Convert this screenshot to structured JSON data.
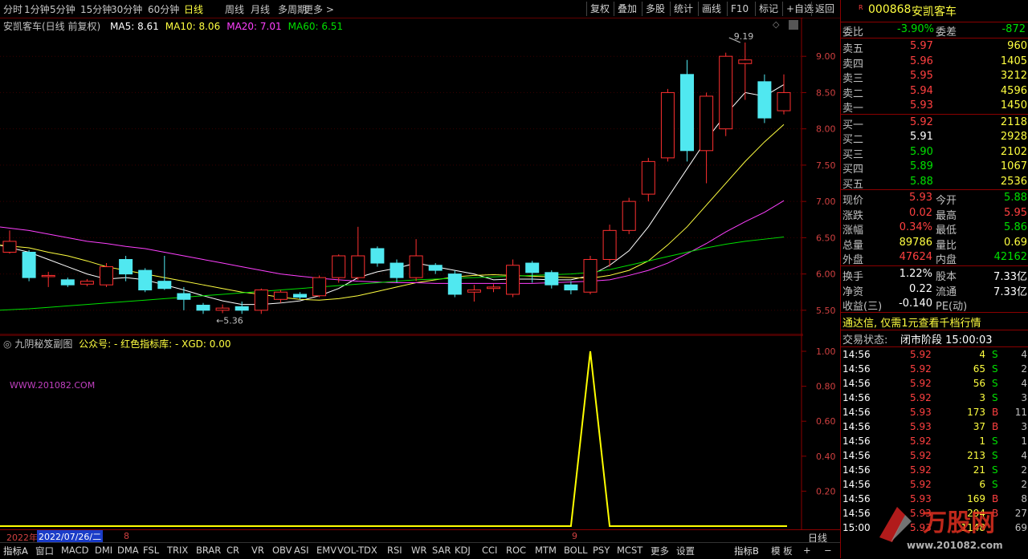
{
  "toolbar": {
    "periods": [
      "分时",
      "1分钟",
      "5分钟",
      "15分钟",
      "30分钟",
      "60分钟",
      "日线",
      "周线",
      "月线",
      "多周期",
      "更多 >"
    ],
    "active_period": "日线",
    "right_buttons": [
      "复权",
      "叠加",
      "多股",
      "统计",
      "画线",
      "F10",
      "标记",
      "+自选",
      "返回"
    ]
  },
  "main_chart": {
    "stock_label": "安凯客车(日线 前复权)",
    "ma_legend": [
      {
        "label": "MA5: 8.61",
        "color": "#ffffff"
      },
      {
        "label": "MA10: 8.06",
        "color": "#ffff40"
      },
      {
        "label": "MA20: 7.01",
        "color": "#ff40ff"
      },
      {
        "label": "MA60: 6.51",
        "color": "#00e000"
      }
    ],
    "high_annotation": "9.19",
    "low_annotation": "5.36",
    "price_ticks": [
      "9.00",
      "8.50",
      "8.00",
      "7.50",
      "7.00",
      "6.50",
      "6.00",
      "5.50"
    ]
  },
  "chart_data": {
    "type": "candlestick",
    "y_range": [
      5.2,
      9.4
    ],
    "candles": [
      {
        "o": 6.3,
        "c": 6.45,
        "h": 6.6,
        "l": 6.28
      },
      {
        "o": 6.3,
        "c": 5.95,
        "h": 6.33,
        "l": 5.9
      },
      {
        "o": 5.98,
        "c": 5.98,
        "h": 6.03,
        "l": 5.82
      },
      {
        "o": 5.92,
        "c": 5.85,
        "h": 5.95,
        "l": 5.82
      },
      {
        "o": 5.86,
        "c": 5.9,
        "h": 5.93,
        "l": 5.83
      },
      {
        "o": 5.85,
        "c": 6.1,
        "h": 6.15,
        "l": 5.82
      },
      {
        "o": 6.2,
        "c": 6.0,
        "h": 6.25,
        "l": 5.9
      },
      {
        "o": 6.05,
        "c": 5.78,
        "h": 6.08,
        "l": 5.75
      },
      {
        "o": 5.9,
        "c": 5.8,
        "h": 6.25,
        "l": 5.78
      },
      {
        "o": 5.73,
        "c": 5.65,
        "h": 5.82,
        "l": 5.5
      },
      {
        "o": 5.57,
        "c": 5.5,
        "h": 5.6,
        "l": 5.45
      },
      {
        "o": 5.5,
        "c": 5.53,
        "h": 5.58,
        "l": 5.46
      },
      {
        "o": 5.55,
        "c": 5.5,
        "h": 5.62,
        "l": 5.45
      },
      {
        "o": 5.5,
        "c": 5.78,
        "h": 5.8,
        "l": 5.45
      },
      {
        "o": 5.65,
        "c": 5.75,
        "h": 5.78,
        "l": 5.6
      },
      {
        "o": 5.72,
        "c": 5.68,
        "h": 5.75,
        "l": 5.65
      },
      {
        "o": 5.7,
        "c": 5.95,
        "h": 5.98,
        "l": 5.68
      },
      {
        "o": 5.95,
        "c": 6.25,
        "h": 6.27,
        "l": 5.88
      },
      {
        "o": 5.95,
        "c": 6.25,
        "h": 6.65,
        "l": 5.92
      },
      {
        "o": 6.35,
        "c": 6.15,
        "h": 6.38,
        "l": 6.1
      },
      {
        "o": 6.15,
        "c": 5.95,
        "h": 6.2,
        "l": 5.88
      },
      {
        "o": 5.95,
        "c": 6.25,
        "h": 6.48,
        "l": 5.9
      },
      {
        "o": 6.12,
        "c": 6.05,
        "h": 6.15,
        "l": 6.0
      },
      {
        "o": 6.0,
        "c": 5.72,
        "h": 6.05,
        "l": 5.68
      },
      {
        "o": 5.75,
        "c": 5.78,
        "h": 5.85,
        "l": 5.62
      },
      {
        "o": 5.8,
        "c": 5.82,
        "h": 5.86,
        "l": 5.75
      },
      {
        "o": 5.72,
        "c": 6.12,
        "h": 6.2,
        "l": 5.68
      },
      {
        "o": 6.15,
        "c": 6.02,
        "h": 6.18,
        "l": 5.88
      },
      {
        "o": 6.02,
        "c": 5.85,
        "h": 6.05,
        "l": 5.8
      },
      {
        "o": 5.85,
        "c": 5.78,
        "h": 5.9,
        "l": 5.72
      },
      {
        "o": 5.75,
        "c": 6.2,
        "h": 6.25,
        "l": 5.72
      },
      {
        "o": 6.2,
        "c": 6.6,
        "h": 6.68,
        "l": 6.1
      },
      {
        "o": 6.6,
        "c": 7.0,
        "h": 7.05,
        "l": 6.55
      },
      {
        "o": 7.1,
        "c": 7.55,
        "h": 7.6,
        "l": 7.0
      },
      {
        "o": 7.6,
        "c": 8.5,
        "h": 8.55,
        "l": 7.55
      },
      {
        "o": 8.75,
        "c": 7.7,
        "h": 8.95,
        "l": 7.55
      },
      {
        "o": 7.7,
        "c": 8.45,
        "h": 8.5,
        "l": 7.25
      },
      {
        "o": 8.0,
        "c": 9.0,
        "h": 9.05,
        "l": 7.9
      },
      {
        "o": 8.9,
        "c": 8.95,
        "h": 9.19,
        "l": 8.4
      },
      {
        "o": 8.65,
        "c": 8.15,
        "h": 8.75,
        "l": 8.08
      },
      {
        "o": 8.25,
        "c": 8.5,
        "h": 8.75,
        "l": 8.2
      }
    ],
    "ma_lines": {
      "MA5": [
        6.4,
        6.3,
        6.2,
        6.1,
        6.0,
        5.93,
        5.95,
        5.92,
        5.85,
        5.78,
        5.7,
        5.63,
        5.58,
        5.58,
        5.6,
        5.63,
        5.7,
        5.8,
        5.95,
        6.03,
        6.08,
        6.15,
        6.1,
        6.05,
        6.0,
        5.92,
        5.93,
        5.93,
        5.92,
        5.92,
        5.98,
        6.12,
        6.32,
        6.65,
        7.05,
        7.45,
        7.85,
        8.2,
        8.5,
        8.45,
        8.61
      ],
      "MA10": [
        6.4,
        6.36,
        6.3,
        6.25,
        6.18,
        6.1,
        6.05,
        6.0,
        5.95,
        5.9,
        5.85,
        5.8,
        5.75,
        5.72,
        5.68,
        5.65,
        5.64,
        5.66,
        5.7,
        5.76,
        5.82,
        5.88,
        5.92,
        5.96,
        5.98,
        5.99,
        5.98,
        5.97,
        5.96,
        5.95,
        5.94,
        5.98,
        6.05,
        6.18,
        6.4,
        6.65,
        6.95,
        7.25,
        7.55,
        7.82,
        8.06
      ],
      "MA20": [
        6.65,
        6.6,
        6.55,
        6.5,
        6.45,
        6.42,
        6.38,
        6.35,
        6.3,
        6.25,
        6.2,
        6.15,
        6.1,
        6.05,
        6.0,
        5.97,
        5.94,
        5.92,
        5.9,
        5.89,
        5.88,
        5.88,
        5.87,
        5.87,
        5.87,
        5.87,
        5.87,
        5.87,
        5.88,
        5.89,
        5.9,
        5.92,
        5.98,
        6.05,
        6.15,
        6.28,
        6.42,
        6.58,
        6.72,
        6.85,
        7.01
      ],
      "MA60": [
        5.5,
        5.52,
        5.54,
        5.56,
        5.58,
        5.6,
        5.62,
        5.64,
        5.66,
        5.68,
        5.7,
        5.72,
        5.74,
        5.76,
        5.78,
        5.8,
        5.82,
        5.84,
        5.86,
        5.88,
        5.9,
        5.92,
        5.93,
        5.94,
        5.95,
        5.96,
        5.97,
        5.98,
        5.99,
        6.0,
        6.02,
        6.06,
        6.12,
        6.18,
        6.24,
        6.3,
        6.36,
        6.41,
        6.45,
        6.48,
        6.51
      ]
    },
    "indicator": {
      "name": "XGD",
      "values": [
        0,
        0,
        0,
        0,
        0,
        0,
        0,
        0,
        0,
        0,
        0,
        0,
        0,
        0,
        0,
        0,
        0,
        0,
        0,
        0,
        0,
        0,
        0,
        0,
        0,
        0,
        0,
        0,
        0,
        0,
        1,
        0,
        0,
        0,
        0,
        0,
        0,
        0,
        0,
        0,
        0
      ],
      "y_range": [
        0,
        1.0
      ],
      "ticks": [
        "1.00",
        "0.80",
        "0.60",
        "0.40",
        "0.20"
      ]
    }
  },
  "sub_chart": {
    "title": "九阴秘笈副图",
    "info": "公众号: -  红色指标库: -  XGD: 0.00",
    "watermark": "WWW.201082.COM"
  },
  "date_axis": {
    "year_label": "2022年",
    "date_cursor": "2022/07/26/二",
    "month_mark_1": "8",
    "month_mark_2": "9",
    "period_label": "日线"
  },
  "bottom_tabs": [
    "指标A",
    "窗口",
    "MACD",
    "DMI",
    "DMA",
    "FSL",
    "TRIX",
    "BRAR",
    "CR",
    "VR",
    "OBV",
    "ASI",
    "EMV",
    "VOL-TDX",
    "RSI",
    "WR",
    "SAR",
    "KDJ",
    "CCI",
    "ROC",
    "MTM",
    "BOLL",
    "PSY",
    "MCST",
    "更多",
    "设置",
    "指标B",
    "模 板",
    "+",
    "−"
  ],
  "quote": {
    "code": "000868",
    "name": "安凯客车",
    "weibi_label": "委比",
    "weibi_value": "-3.90%",
    "weicha_label": "委差",
    "weicha_value": "-872",
    "asks": [
      {
        "label": "卖五",
        "price": "5.97",
        "vol": "960"
      },
      {
        "label": "卖四",
        "price": "5.96",
        "vol": "1405"
      },
      {
        "label": "卖三",
        "price": "5.95",
        "vol": "3212"
      },
      {
        "label": "卖二",
        "price": "5.94",
        "vol": "4596"
      },
      {
        "label": "卖一",
        "price": "5.93",
        "vol": "1450"
      }
    ],
    "bids": [
      {
        "label": "买一",
        "price": "5.92",
        "vol": "2118",
        "color": "red"
      },
      {
        "label": "买二",
        "price": "5.91",
        "vol": "2928",
        "color": "white"
      },
      {
        "label": "买三",
        "price": "5.90",
        "vol": "2102",
        "color": "green"
      },
      {
        "label": "买四",
        "price": "5.89",
        "vol": "1067",
        "color": "green"
      },
      {
        "label": "买五",
        "price": "5.88",
        "vol": "2536",
        "color": "green"
      }
    ],
    "stats": [
      {
        "l1": "现价",
        "v1": "5.93",
        "c1": "red",
        "l2": "今开",
        "v2": "5.88",
        "c2": "green"
      },
      {
        "l1": "涨跌",
        "v1": "0.02",
        "c1": "red",
        "l2": "最高",
        "v2": "5.95",
        "c2": "red"
      },
      {
        "l1": "涨幅",
        "v1": "0.34%",
        "c1": "red",
        "l2": "最低",
        "v2": "5.86",
        "c2": "green"
      },
      {
        "l1": "总量",
        "v1": "89786",
        "c1": "yellow",
        "l2": "量比",
        "v2": "0.69",
        "c2": "yellow"
      },
      {
        "l1": "外盘",
        "v1": "47624",
        "c1": "red",
        "l2": "内盘",
        "v2": "42162",
        "c2": "green"
      }
    ],
    "fin": [
      {
        "l1": "换手",
        "v1": "1.22%",
        "l2": "股本",
        "v2": "7.33亿"
      },
      {
        "l1": "净资",
        "v1": "0.22",
        "l2": "流通",
        "v2": "7.33亿"
      },
      {
        "l1": "收益(三)",
        "v1": "-0.140",
        "l2": "PE(动)",
        "v2": ""
      }
    ],
    "promo": "通达信, 仅需1元查看千档行情",
    "trade_status_label": "交易状态:",
    "trade_status": "闭市阶段 15:00:03",
    "ticks": [
      {
        "t": "14:56",
        "p": "5.92",
        "pc": "red",
        "v": "4",
        "s": "S",
        "n": "4"
      },
      {
        "t": "14:56",
        "p": "5.92",
        "pc": "red",
        "v": "65",
        "s": "S",
        "n": "2"
      },
      {
        "t": "14:56",
        "p": "5.92",
        "pc": "red",
        "v": "56",
        "s": "S",
        "n": "4"
      },
      {
        "t": "14:56",
        "p": "5.92",
        "pc": "red",
        "v": "3",
        "s": "S",
        "n": "3"
      },
      {
        "t": "14:56",
        "p": "5.93",
        "pc": "red",
        "v": "173",
        "s": "B",
        "n": "11"
      },
      {
        "t": "14:56",
        "p": "5.93",
        "pc": "red",
        "v": "37",
        "s": "B",
        "n": "3"
      },
      {
        "t": "14:56",
        "p": "5.92",
        "pc": "red",
        "v": "1",
        "s": "S",
        "n": "1"
      },
      {
        "t": "14:56",
        "p": "5.92",
        "pc": "red",
        "v": "213",
        "s": "S",
        "n": "4"
      },
      {
        "t": "14:56",
        "p": "5.92",
        "pc": "red",
        "v": "21",
        "s": "S",
        "n": "2"
      },
      {
        "t": "14:56",
        "p": "5.92",
        "pc": "red",
        "v": "6",
        "s": "S",
        "n": "2"
      },
      {
        "t": "14:56",
        "p": "5.93",
        "pc": "red",
        "v": "169",
        "s": "B",
        "n": "8"
      },
      {
        "t": "14:56",
        "p": "5.93",
        "pc": "red",
        "v": "294",
        "s": "B",
        "n": "27"
      },
      {
        "t": "15:00",
        "p": "5.93",
        "pc": "red",
        "v": "1148",
        "s": "",
        "n": "69"
      }
    ],
    "watermark": "万股网",
    "watermark_url": "www.201082.com"
  },
  "colors": {
    "up": "#ff3030",
    "down": "#50e8f0",
    "grid": "#8b0000",
    "ma5": "#ffffff",
    "ma10": "#ffff40",
    "ma20": "#ff40ff",
    "ma60": "#00e000",
    "indicator": "#ffff00"
  }
}
